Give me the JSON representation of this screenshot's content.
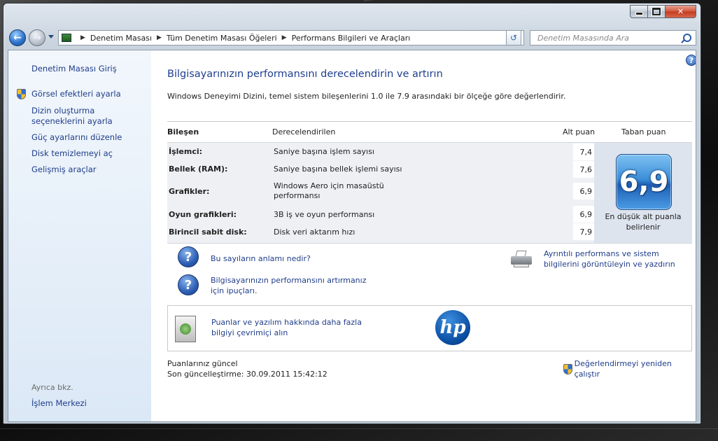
{
  "window": {
    "minimize_label": "—",
    "maximize_label": "□",
    "close_label": "✕"
  },
  "address_bar": {
    "crumbs": [
      "Denetim Masası",
      "Tüm Denetim Masası Öğeleri",
      "Performans Bilgileri ve Araçları"
    ]
  },
  "search": {
    "placeholder": "Denetim Masasında Ara"
  },
  "sidebar": {
    "home": "Denetim Masası Giriş",
    "items": [
      "Görsel efektleri ayarla",
      "Dizin oluşturma seçeneklerini ayarla",
      "Güç ayarlarını düzenle",
      "Disk temizlemeyi aç",
      "Gelişmiş araçlar"
    ],
    "see_also": "Ayrıca bkz.",
    "action_center": "İşlem Merkezi"
  },
  "main": {
    "title": "Bilgisayarınızın performansını derecelendirin ve artırın",
    "subtitle": "Windows Deneyimi Dizini, temel sistem bileşenlerini 1.0 ile 7.9 arasındaki bir ölçeğe göre değerlendirir.",
    "table": {
      "headers": {
        "component": "Bileşen",
        "rated": "Derecelendirilen",
        "subscore": "Alt puan",
        "basescore": "Taban puan"
      },
      "rows": [
        {
          "component": "İşlemci:",
          "rated": "Saniye başına işlem sayısı",
          "score": "7,4"
        },
        {
          "component": "Bellek (RAM):",
          "rated": "Saniye başına bellek işlemi sayısı",
          "score": "7,6"
        },
        {
          "component": "Grafikler:",
          "rated": "Windows Aero için masaüstü performansı",
          "score": "6,9"
        },
        {
          "component": "Oyun grafikleri:",
          "rated": "3B iş ve oyun performansı",
          "score": "6,9"
        },
        {
          "component": "Birincil sabit disk:",
          "rated": "Disk veri aktarım hızı",
          "score": "7,9"
        }
      ],
      "base_score": "6,9",
      "base_caption": "En düşük alt puanla belirlenir"
    },
    "links": {
      "meaning": "Bu sayıların anlamı nedir?",
      "tips": "Bilgisayarınızın performansını artırmanız için ipuçları.",
      "print": "Ayrıntılı performans ve sistem bilgilerini görüntüleyin ve yazdırın",
      "online": "Puanlar ve yazılım hakkında daha fazla bilgiyi çevrimiçi alın"
    },
    "hp_logo": "hp",
    "status": {
      "current": "Puanlarınız güncel",
      "last_update": "Son güncelleştirme: 30.09.2011 15:42:12"
    },
    "rerun": "Değerlendirmeyi yeniden çalıştır"
  }
}
